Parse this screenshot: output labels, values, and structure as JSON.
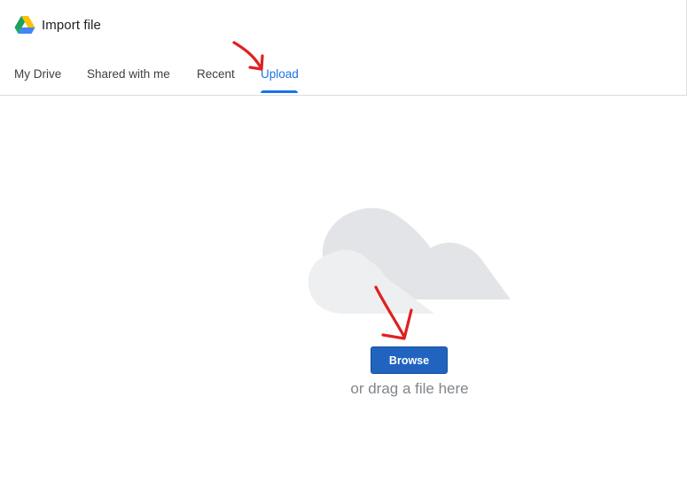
{
  "header": {
    "logo_icon": "google-drive-logo",
    "title": "Import file"
  },
  "tabs": [
    {
      "label": "My Drive",
      "active": false
    },
    {
      "label": "Shared with me",
      "active": false
    },
    {
      "label": "Recent",
      "active": false
    },
    {
      "label": "Upload",
      "active": true
    }
  ],
  "upload": {
    "illustration_icon": "cloud-illustration",
    "browse_label": "Browse",
    "drag_text": "or drag a file here"
  },
  "annotations": {
    "arrow_icon": "red-hand-drawn-arrow",
    "arrow_color": "#e02020"
  },
  "colors": {
    "accent": "#1a73e8",
    "button": "#2164c0",
    "muted_text": "#80868b",
    "cloud_back": "#e3e4e7",
    "cloud_front": "#eeeff1"
  }
}
